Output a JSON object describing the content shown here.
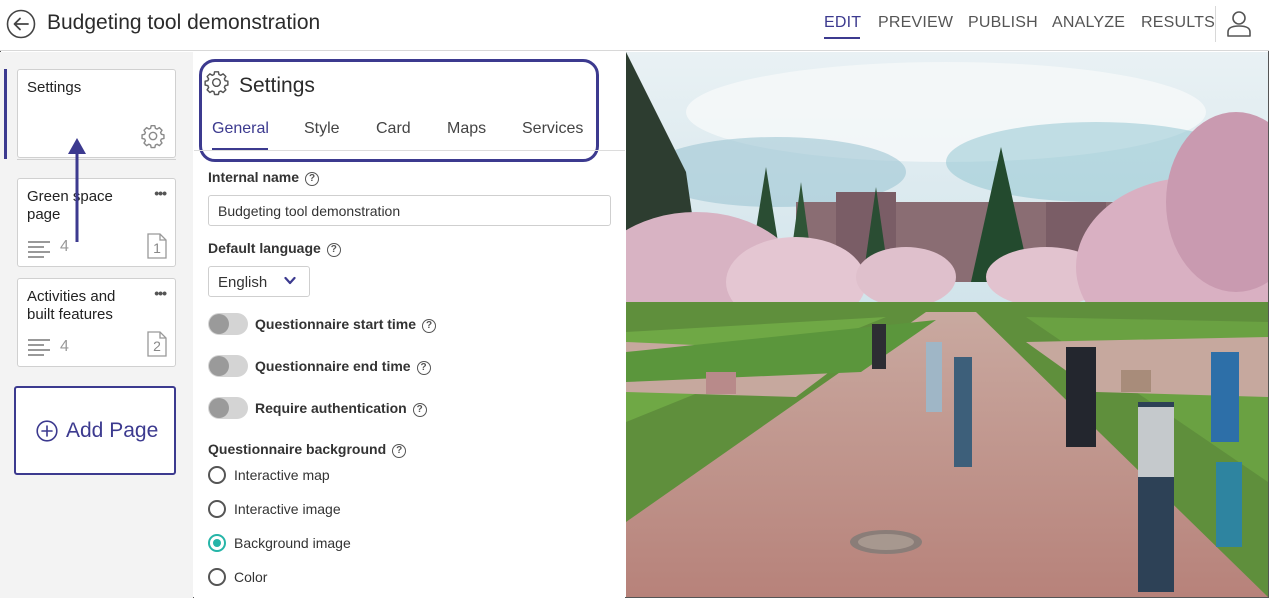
{
  "header": {
    "title": "Budgeting tool demonstration",
    "nav": [
      "EDIT",
      "PREVIEW",
      "PUBLISH",
      "ANALYZE",
      "RESULTS"
    ],
    "active_nav": "EDIT"
  },
  "sidebar": {
    "cards": [
      {
        "title": "Settings"
      },
      {
        "title": "Green space page",
        "more": "•••",
        "count": "4",
        "page_num": "1"
      },
      {
        "title": "Activities and built features",
        "more": "•••",
        "count": "4",
        "page_num": "2"
      }
    ],
    "add_page_label": "Add Page"
  },
  "settings": {
    "title": "Settings",
    "tabs": [
      "General",
      "Style",
      "Card",
      "Maps",
      "Services"
    ],
    "active_tab": "General",
    "internal_name_label": "Internal name",
    "internal_name_value": "Budgeting tool demonstration",
    "default_language_label": "Default language",
    "default_language_value": "English",
    "toggles": [
      {
        "label": "Questionnaire start time",
        "on": false
      },
      {
        "label": "Questionnaire end time",
        "on": false
      },
      {
        "label": "Require authentication",
        "on": false
      }
    ],
    "background_label": "Questionnaire background",
    "background_options": [
      "Interactive map",
      "Interactive image",
      "Background image",
      "Color"
    ],
    "background_selected": "Background image",
    "help_glyph": "?"
  },
  "colors": {
    "accent": "#3c3a8f",
    "radio_selected": "#26b5a8"
  },
  "icons": {
    "back": "back-arrow-icon",
    "user": "user-icon",
    "settings": "gear-icon",
    "add": "plus-circle-icon",
    "lines": "lines-icon",
    "annotation": "up-arrow-annotation"
  }
}
